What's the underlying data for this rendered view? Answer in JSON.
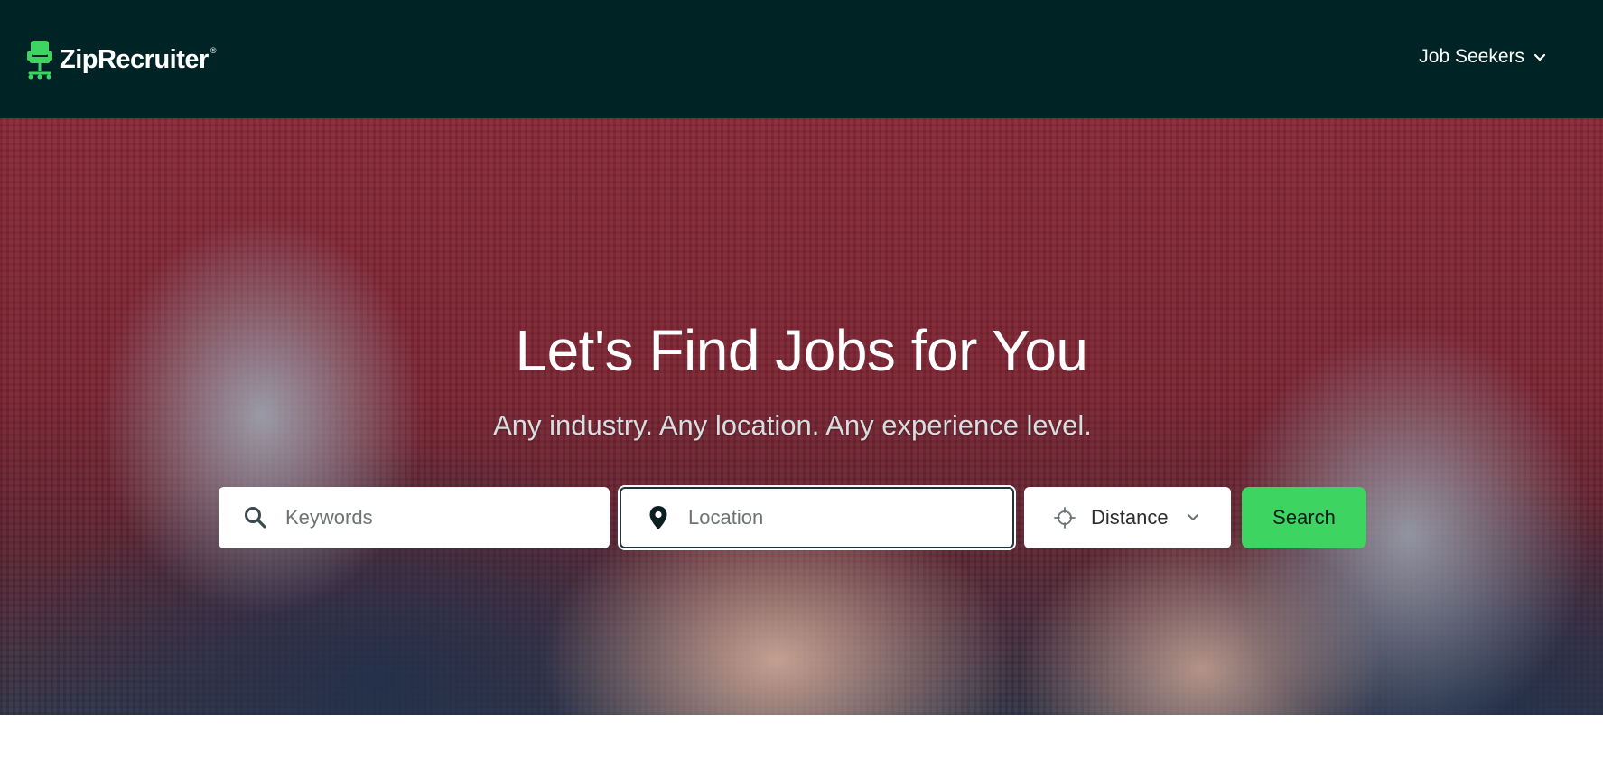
{
  "header": {
    "logo_text": "ZipRecruiter",
    "logo_mark": "®",
    "nav_menu_label": "Job Seekers"
  },
  "hero": {
    "title": "Let's Find Jobs for You",
    "subtitle": "Any industry. Any location. Any experience level."
  },
  "search": {
    "keywords_placeholder": "Keywords",
    "keywords_value": "",
    "location_placeholder": "Location",
    "location_value": "",
    "distance_label": "Distance",
    "button_label": "Search"
  },
  "icons": {
    "logo": "chair-icon",
    "nav_chevron": "chevron-down-icon",
    "keywords": "search-icon",
    "location": "map-pin-icon",
    "distance": "crosshair-icon",
    "distance_chevron": "chevron-down-icon"
  },
  "colors": {
    "header_bg": "#002326",
    "brand_green": "#3ed461",
    "text_dark": "#2d2d2d"
  }
}
